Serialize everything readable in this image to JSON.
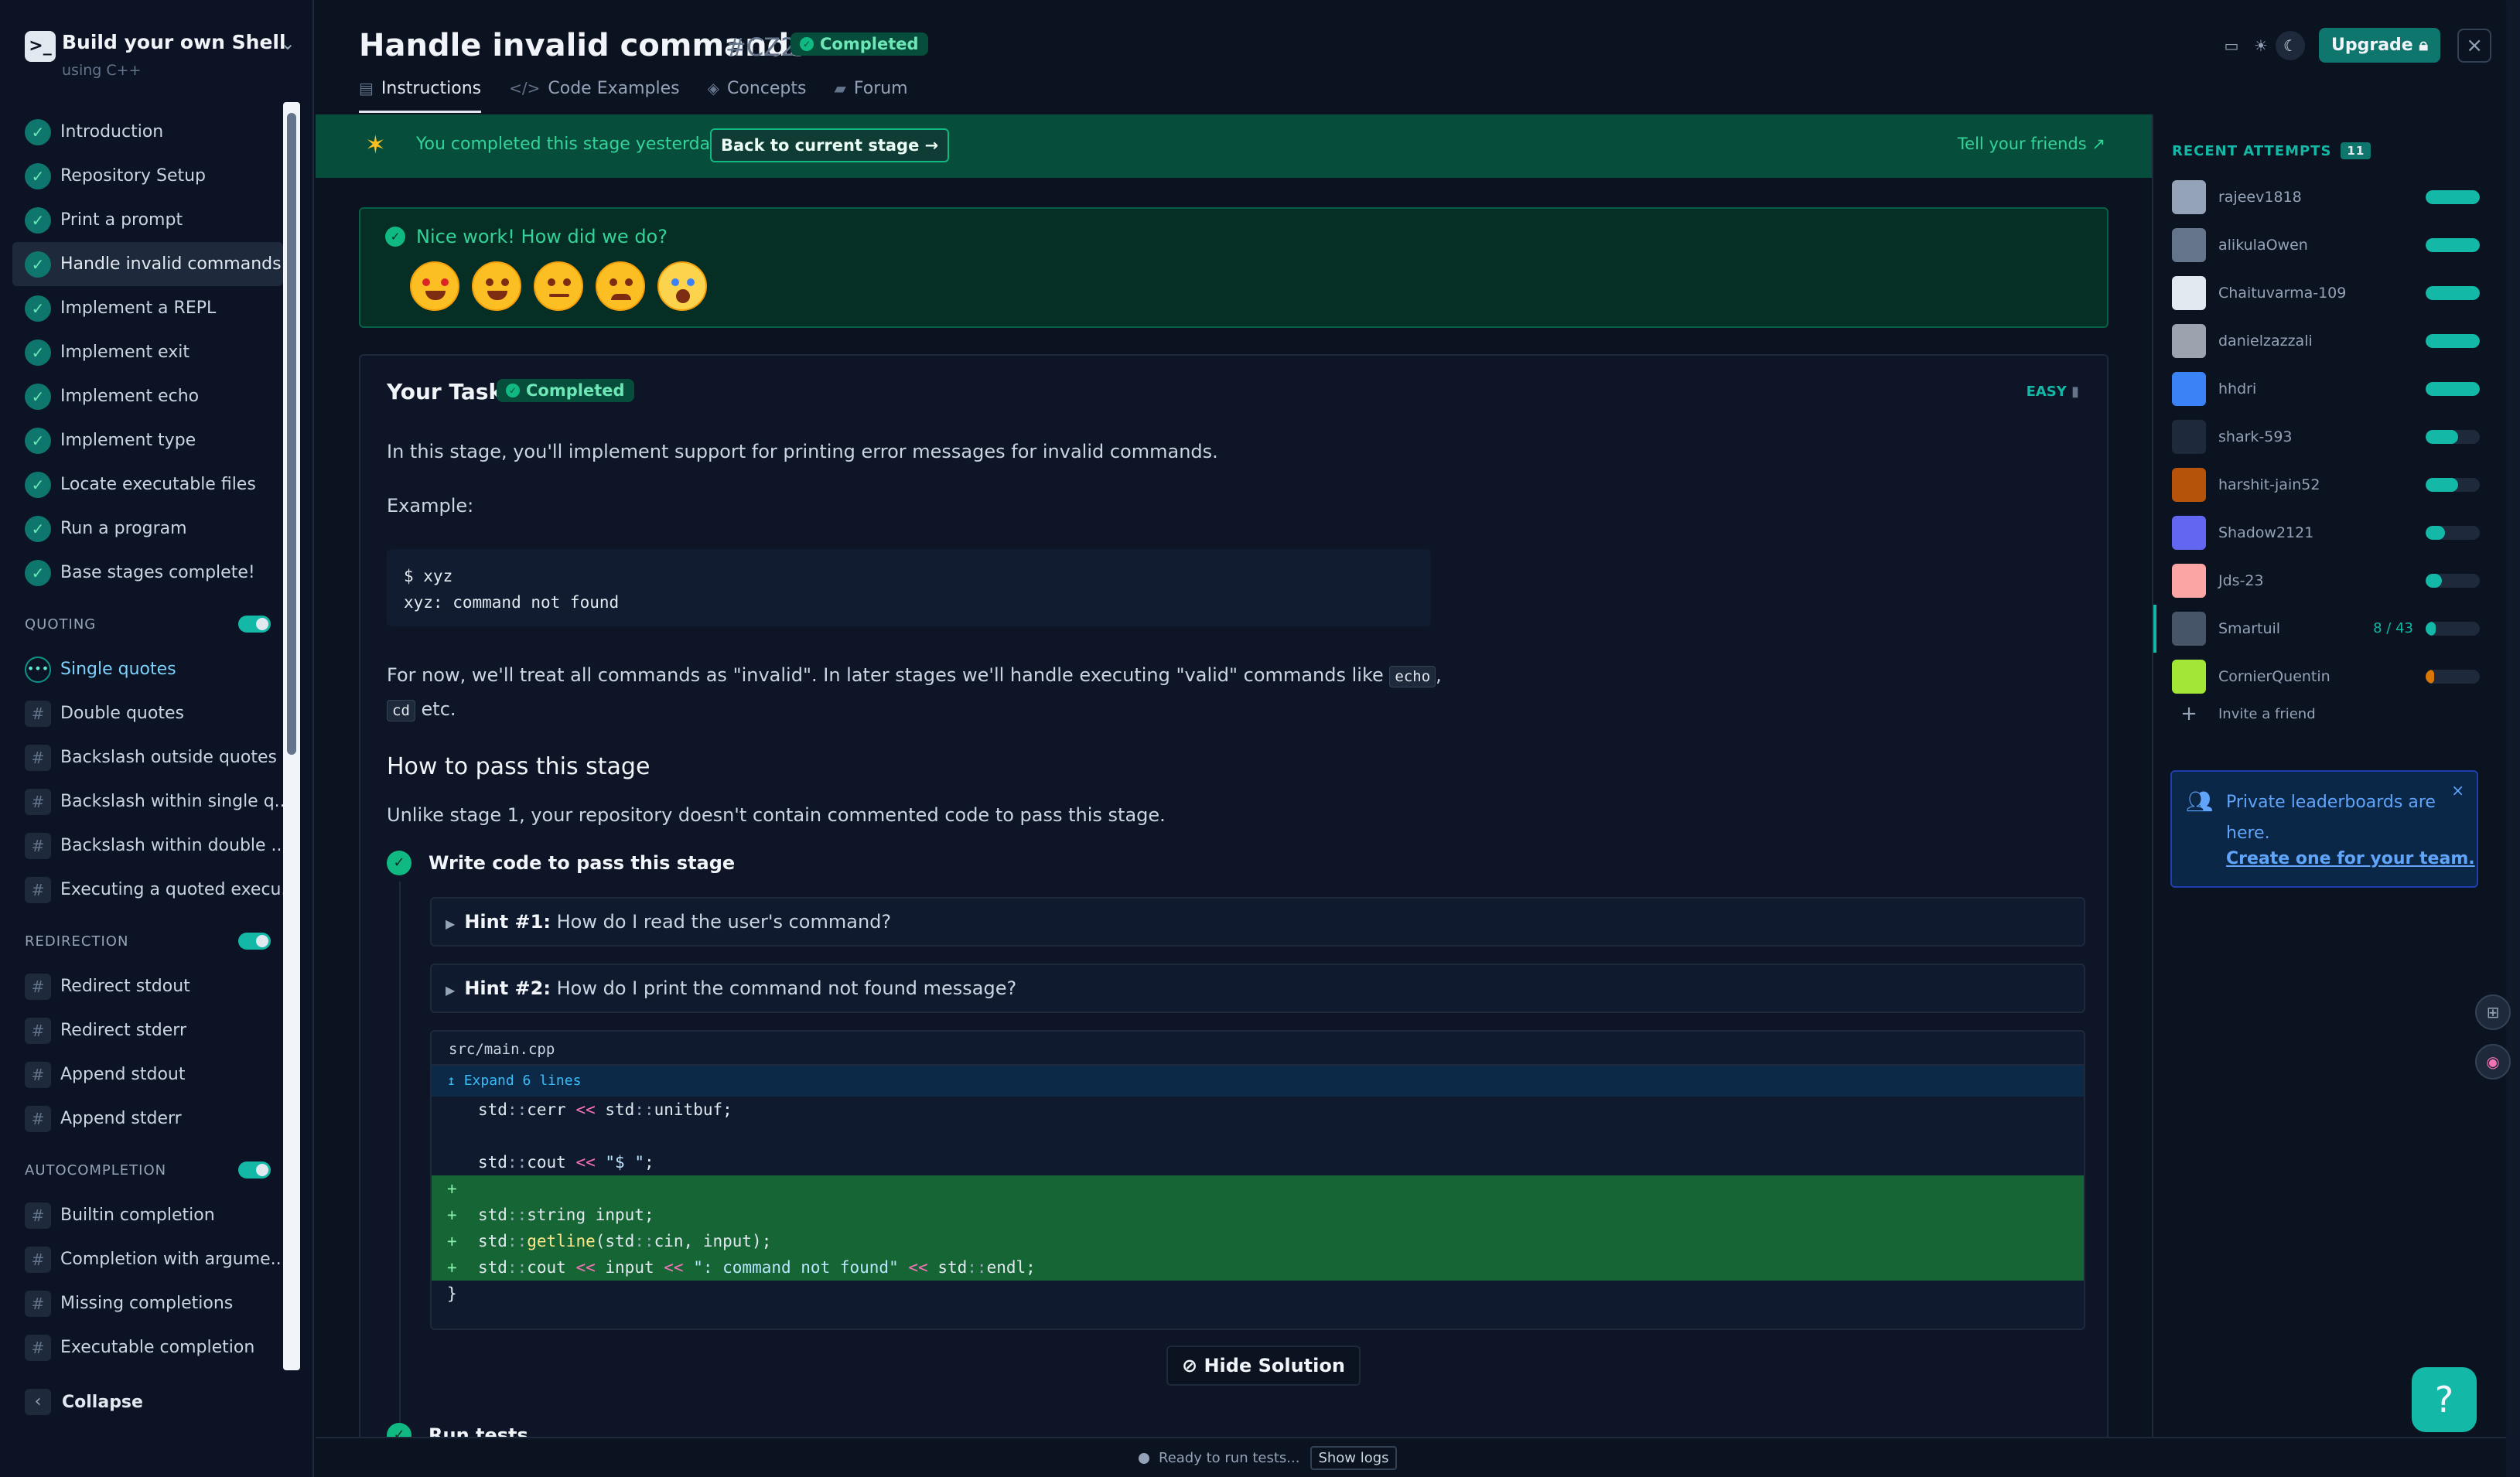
{
  "sidebar": {
    "title": "Build your own Shell",
    "subtitle": "using C++",
    "base_stages": [
      "Introduction",
      "Repository Setup",
      "Print a prompt",
      "Handle invalid commands",
      "Implement a REPL",
      "Implement exit",
      "Implement echo",
      "Implement type",
      "Locate executable files",
      "Run a program",
      "Base stages complete!"
    ],
    "active_index": 3,
    "sections": [
      {
        "title": "QUOTING",
        "items": [
          "Single quotes",
          "Double quotes",
          "Backslash outside quotes",
          "Backslash within single q...",
          "Backslash within double ...",
          "Executing a quoted execu..."
        ],
        "current_index": 0
      },
      {
        "title": "REDIRECTION",
        "items": [
          "Redirect stdout",
          "Redirect stderr",
          "Append stdout",
          "Append stderr"
        ]
      },
      {
        "title": "AUTOCOMPLETION",
        "items": [
          "Builtin completion",
          "Completion with argume...",
          "Missing completions",
          "Executable completion"
        ]
      }
    ],
    "collapse_label": "Collapse"
  },
  "header": {
    "title": "Handle invalid commands",
    "stage_code": "#CZ2",
    "status": "Completed",
    "tabs": [
      "Instructions",
      "Code Examples",
      "Concepts",
      "Forum"
    ],
    "upgrade_label": "Upgrade"
  },
  "banner": {
    "text": "You completed this stage yesterday.",
    "button": "Back to current stage →",
    "tell_friends": "Tell your friends"
  },
  "feedback": {
    "question": "Nice work! How did we do?"
  },
  "task": {
    "title": "Your Task",
    "status": "Completed",
    "difficulty": "EASY",
    "intro": "In this stage, you'll implement support for printing error messages for invalid commands.",
    "example_label": "Example:",
    "example_lines": [
      "$ xyz",
      "xyz: command not found"
    ],
    "treat_text": "For now, we'll treat all commands as \"invalid\". In later stages we'll handle executing \"valid\" commands like",
    "cmd_echo": "echo",
    "comma": ",",
    "cmd_cd": "cd",
    "etc": "etc.",
    "how_heading": "How to pass this stage",
    "how_text": "Unlike stage 1, your repository doesn't contain commented code to pass this stage.",
    "step1": "Write code to pass this stage",
    "hint1_label": "Hint #1:",
    "hint1_text": "How do I read the user's command?",
    "hint2_label": "Hint #2:",
    "hint2_text": "How do I print the command not found message?",
    "diff_file": "src/main.cpp",
    "diff_expand": "Expand 6 lines",
    "hide_solution": "Hide Solution",
    "step2": "Run tests"
  },
  "recent": {
    "title": "RECENT ATTEMPTS",
    "count": "11",
    "attempts": [
      {
        "name": "rajeev1818",
        "progress": 1.0,
        "color": "#14b8a6",
        "avatar": "#94a3b8"
      },
      {
        "name": "alikulaOwen",
        "progress": 1.0,
        "color": "#14b8a6",
        "avatar": "#64748b"
      },
      {
        "name": "Chaituvarma-109",
        "progress": 1.0,
        "color": "#14b8a6",
        "avatar": "#e2e8f0"
      },
      {
        "name": "danielzazzali",
        "progress": 1.0,
        "color": "#14b8a6",
        "avatar": "#9ca3af"
      },
      {
        "name": "hhdri",
        "progress": 1.0,
        "color": "#14b8a6",
        "avatar": "#3b82f6"
      },
      {
        "name": "shark-593",
        "progress": 0.6,
        "color": "#14b8a6",
        "avatar": "#1e293b"
      },
      {
        "name": "harshit-jain52",
        "progress": 0.6,
        "color": "#14b8a6",
        "avatar": "#b45309"
      },
      {
        "name": "Shadow2121",
        "progress": 0.35,
        "color": "#14b8a6",
        "avatar": "#6366f1"
      },
      {
        "name": "Jds-23",
        "progress": 0.3,
        "color": "#14b8a6",
        "avatar": "#fca5a5"
      },
      {
        "name": "Smartuil",
        "progress": 0.19,
        "color": "#14b8a6",
        "avatar": "#475569",
        "score": "8 / 43"
      },
      {
        "name": "CornierQuentin",
        "progress": 0.15,
        "color": "#d97706",
        "avatar": "#a3e635"
      }
    ],
    "invite": "Invite a friend",
    "leaderboard_text": "Private leaderboards are here.",
    "leaderboard_link": "Create one for your team."
  },
  "footer": {
    "status": "Ready to run tests...",
    "show_logs": "Show logs"
  }
}
